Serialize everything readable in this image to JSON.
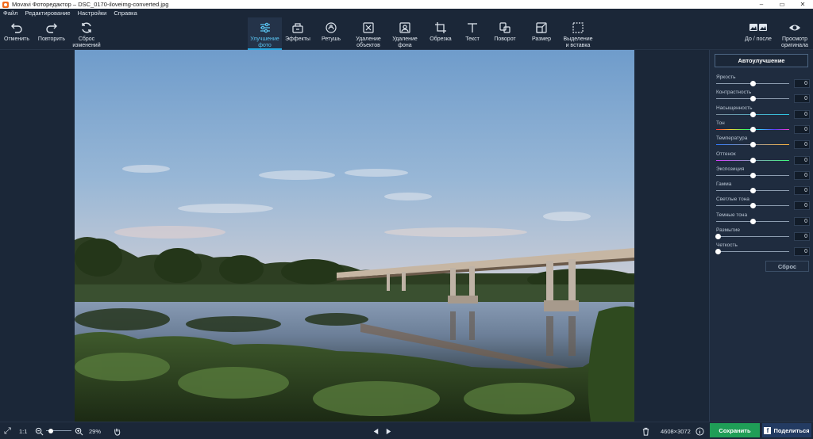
{
  "window": {
    "title": "Movavi Фоторедактор – DSC_0170-iloveimg-converted.jpg",
    "minimize": "–",
    "maximize": "▭",
    "close": "✕"
  },
  "menu": [
    "Файл",
    "Редактирование",
    "Настройки",
    "Справка"
  ],
  "toolbar": {
    "undo": "Отменить",
    "redo": "Повторить",
    "reset_changes": "Сброс\nизменений",
    "tools": [
      {
        "label": "Улучшение\nфото",
        "icon": "sliders-icon",
        "active": true
      },
      {
        "label": "Эффекты",
        "icon": "effects-icon",
        "active": false
      },
      {
        "label": "Ретушь",
        "icon": "retouch-icon",
        "active": false
      },
      {
        "label": "Удаление\nобъектов",
        "icon": "object-removal-icon",
        "active": false
      },
      {
        "label": "Удаление\nфона",
        "icon": "background-removal-icon",
        "active": false
      },
      {
        "label": "Обрезка",
        "icon": "crop-icon",
        "active": false
      },
      {
        "label": "Текст",
        "icon": "text-icon",
        "active": false
      },
      {
        "label": "Поворот",
        "icon": "rotate-icon",
        "active": false
      },
      {
        "label": "Размер",
        "icon": "resize-icon",
        "active": false
      },
      {
        "label": "Выделение\nи вставка",
        "icon": "selection-icon",
        "active": false
      }
    ],
    "before_after": "До / после",
    "view_original": "Просмотр\nоригинала"
  },
  "panel": {
    "auto_enhance": "Автоулучшение",
    "sliders": [
      {
        "label": "Яркость",
        "value": "0",
        "position": 0.5,
        "track": "gray"
      },
      {
        "label": "Контрастность",
        "value": "0",
        "position": 0.5,
        "track": "gray"
      },
      {
        "label": "Насыщенность",
        "value": "0",
        "position": 0.5,
        "track": "saturation"
      },
      {
        "label": "Тон",
        "value": "0",
        "position": 0.5,
        "track": "hue"
      },
      {
        "label": "Температура",
        "value": "0",
        "position": 0.5,
        "track": "temperature"
      },
      {
        "label": "Оттенок",
        "value": "0",
        "position": 0.5,
        "track": "tint"
      },
      {
        "label": "Экспозиция",
        "value": "0",
        "position": 0.5,
        "track": "gray"
      },
      {
        "label": "Гамма",
        "value": "0",
        "position": 0.5,
        "track": "gray"
      },
      {
        "label": "Светлые тона",
        "value": "0",
        "position": 0.5,
        "track": "gray"
      },
      {
        "label": "Темные тона",
        "value": "0",
        "position": 0.5,
        "track": "gray"
      },
      {
        "label": "Размытие",
        "value": "0",
        "position": 0,
        "track": "gray"
      },
      {
        "label": "Четкость",
        "value": "0",
        "position": 0,
        "track": "gray"
      }
    ],
    "reset": "Сброс"
  },
  "status": {
    "fit": "⤢",
    "actual_size": "1:1",
    "zoom": "29%",
    "zoom_level": 0.29,
    "dimensions": "4608×3072",
    "save": "Сохранить",
    "share": "Поделиться"
  },
  "colors": {
    "accent": "#2aa8e0",
    "save": "#1f9e57",
    "share": "#233b62",
    "bg": "#1b2738"
  }
}
